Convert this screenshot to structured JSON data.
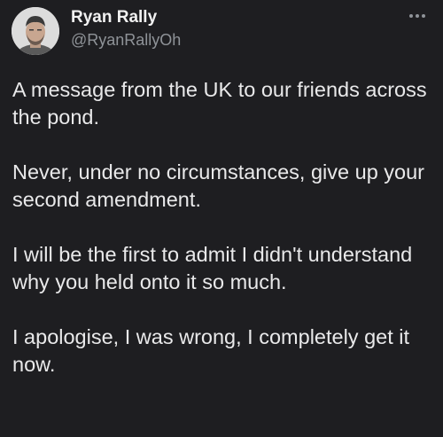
{
  "author": {
    "display_name": "Ryan Rally",
    "handle": "@RyanRallyOh"
  },
  "more_icon": "more-horizontal-icon",
  "tweet": {
    "paragraphs": [
      "A message from the UK to our friends across the pond.",
      "Never, under no circumstances, give up your second amendment.",
      "I will be the first to admit I didn't understand why you held onto it so much.",
      "I apologise, I was wrong, I completely get it now."
    ]
  },
  "colors": {
    "background": "#1e1e21",
    "text": "#e9e9ea",
    "secondary_text": "#8f9398"
  }
}
